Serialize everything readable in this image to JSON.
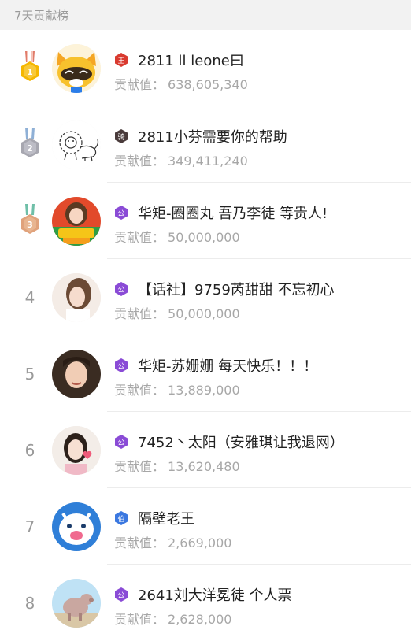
{
  "header": {
    "title": "7天贡献榜"
  },
  "score_label": "贡献值：",
  "colors": {
    "gold": "#f5b700",
    "silver": "#a7a7b0",
    "bronze": "#e0a27b",
    "purple": "#8a4bd6",
    "blue": "#3b78e0",
    "red": "#d93a2f",
    "dark": "#4a3b3b"
  },
  "rows": [
    {
      "rank": "1",
      "medal": "gold-medal",
      "badge_text": "王",
      "badge_color": "#d93a2f",
      "name": "2811 ll leone曰",
      "score": "638,605,340",
      "avatar": "raccoon-avatar"
    },
    {
      "rank": "2",
      "medal": "silver-medal",
      "badge_text": "骑",
      "badge_color": "#4a3b3b",
      "name": "2811小芬需要你的帮助",
      "score": "349,411,240",
      "avatar": "lion-sketch-avatar"
    },
    {
      "rank": "3",
      "medal": "bronze-medal",
      "badge_text": "公",
      "badge_color": "#8a4bd6",
      "name": "华矩-圈圈丸 吾乃李徒 等贵人!",
      "score": "50,000,000",
      "avatar": "character-avatar"
    },
    {
      "rank": "4",
      "badge_text": "公",
      "badge_color": "#8a4bd6",
      "name": "【话社】9759芮甜甜 不忘初心",
      "score": "50,000,000",
      "avatar": "girl-avatar"
    },
    {
      "rank": "5",
      "badge_text": "公",
      "badge_color": "#8a4bd6",
      "name": "华矩-苏姗姗 每天快乐！！！",
      "score": "13,889,000",
      "avatar": "woman-avatar"
    },
    {
      "rank": "6",
      "badge_text": "公",
      "badge_color": "#8a4bd6",
      "name": "7452丶太阳（安雅琪让我退网）",
      "score": "13,620,480",
      "avatar": "girl-heart-avatar"
    },
    {
      "rank": "7",
      "badge_text": "伯",
      "badge_color": "#3b78e0",
      "name": "隔壁老王",
      "score": "2,669,000",
      "avatar": "cartoon-avatar"
    },
    {
      "rank": "8",
      "badge_text": "公",
      "badge_color": "#8a4bd6",
      "name": "2641刘大洋冕徒 个人票",
      "score": "2,628,000",
      "avatar": "pig-avatar"
    }
  ]
}
